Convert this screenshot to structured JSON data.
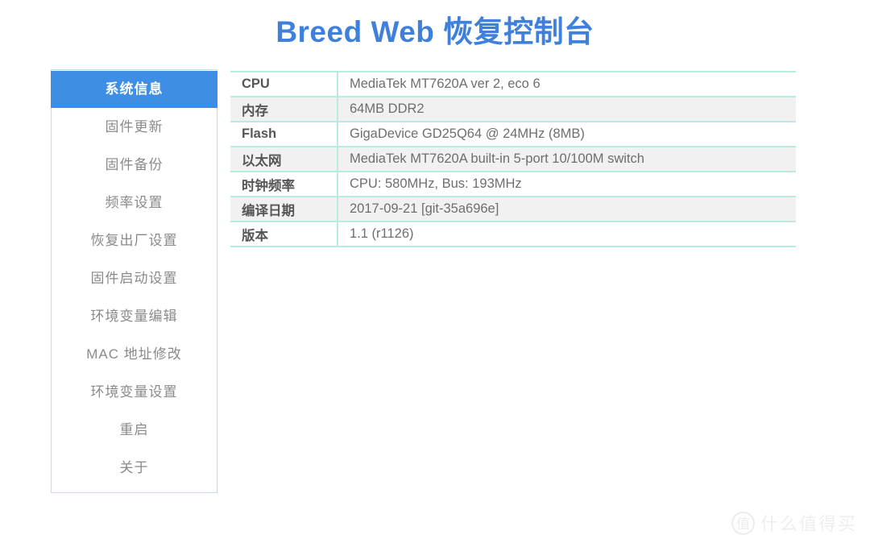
{
  "header": {
    "title": "Breed Web 恢复控制台",
    "title_color": "#3f80dd"
  },
  "sidebar": {
    "active_index": 0,
    "active_bg_color": "#3d8ee4",
    "border_color": "#b7e6dc",
    "items": [
      {
        "label": "系统信息"
      },
      {
        "label": "固件更新"
      },
      {
        "label": "固件备份"
      },
      {
        "label": "频率设置"
      },
      {
        "label": "恢复出厂设置"
      },
      {
        "label": "固件启动设置"
      },
      {
        "label": "环境变量编辑"
      },
      {
        "label": "MAC 地址修改"
      },
      {
        "label": "环境变量设置"
      },
      {
        "label": "重启"
      },
      {
        "label": "关于"
      }
    ]
  },
  "system_info": {
    "border_color": "#b9ece0",
    "rows": [
      {
        "label": "CPU",
        "value": "MediaTek MT7620A ver 2, eco 6"
      },
      {
        "label": "内存",
        "value": "64MB DDR2"
      },
      {
        "label": "Flash",
        "value": "GigaDevice GD25Q64 @ 24MHz (8MB)"
      },
      {
        "label": "以太网",
        "value": "MediaTek MT7620A built-in 5-port 10/100M switch"
      },
      {
        "label": "时钟频率",
        "value": "CPU: 580MHz, Bus: 193MHz"
      },
      {
        "label": "编译日期",
        "value": "2017-09-21 [git-35a696e]"
      },
      {
        "label": "版本",
        "value": "1.1 (r1126)"
      }
    ]
  },
  "watermark": {
    "badge": "值",
    "text": "什么值得买"
  }
}
